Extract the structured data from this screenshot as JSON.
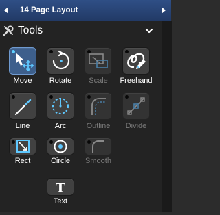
{
  "header": {
    "title": "14 Page Layout"
  },
  "tools_panel": {
    "title": "Tools",
    "tools": [
      {
        "label": "Move",
        "icon": "move-icon",
        "state": "selected"
      },
      {
        "label": "Rotate",
        "icon": "rotate-icon",
        "state": "enabled"
      },
      {
        "label": "Scale",
        "icon": "scale-icon",
        "state": "disabled"
      },
      {
        "label": "Freehand",
        "icon": "freehand-icon",
        "state": "enabled"
      },
      {
        "label": "Line",
        "icon": "line-icon",
        "state": "enabled"
      },
      {
        "label": "Arc",
        "icon": "arc-icon",
        "state": "enabled"
      },
      {
        "label": "Outline",
        "icon": "outline-icon",
        "state": "disabled"
      },
      {
        "label": "Divide",
        "icon": "divide-icon",
        "state": "disabled"
      },
      {
        "label": "Rect",
        "icon": "rect-icon",
        "state": "enabled"
      },
      {
        "label": "Circle",
        "icon": "circle-icon",
        "state": "enabled"
      },
      {
        "label": "Smooth",
        "icon": "smooth-icon",
        "state": "disabled"
      }
    ],
    "text_tool": {
      "label": "Text",
      "glyph": "T",
      "icon": "text-icon"
    }
  },
  "colors": {
    "accent": "#2e8fd6",
    "selected_background": "#3d5f8c",
    "header_bar": "#2a4679"
  }
}
